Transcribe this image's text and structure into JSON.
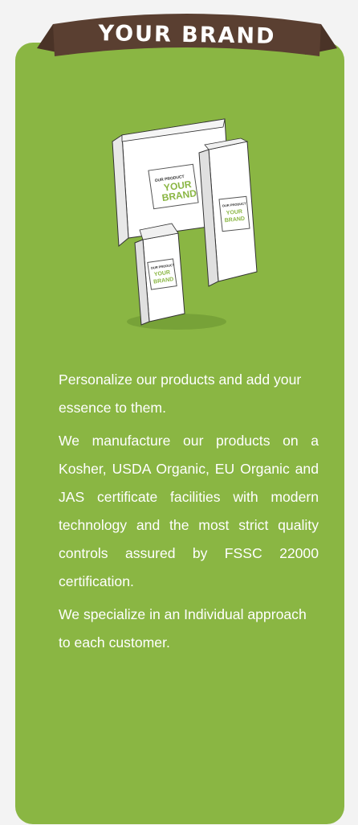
{
  "banner": {
    "title": "YOUR BRAND",
    "ribbon_color": "#5a3f31",
    "card_color": "#8ab643"
  },
  "illustration": {
    "large_bag": {
      "small_text": "OUR PRODUCT",
      "line1": "YOUR",
      "line2": "BRAND"
    },
    "tall_bag": {
      "small_text": "OUR PRODUCT",
      "line1": "YOUR",
      "line2": "BRAND"
    },
    "small_bag": {
      "small_text": "OUR PRODUCT",
      "line1": "YOUR",
      "line2": "BRAND"
    }
  },
  "content": {
    "paragraph1": "Personalize our products and add your essence to them.",
    "paragraph2": "We manufacture our products on a Kosher, USDA Organic,  EU Organic and JAS certificate facilities with modern technology and the most strict quality controls assured by FSSC 22000 certification.",
    "paragraph3": "We specialize in an Individual approach to each customer."
  }
}
